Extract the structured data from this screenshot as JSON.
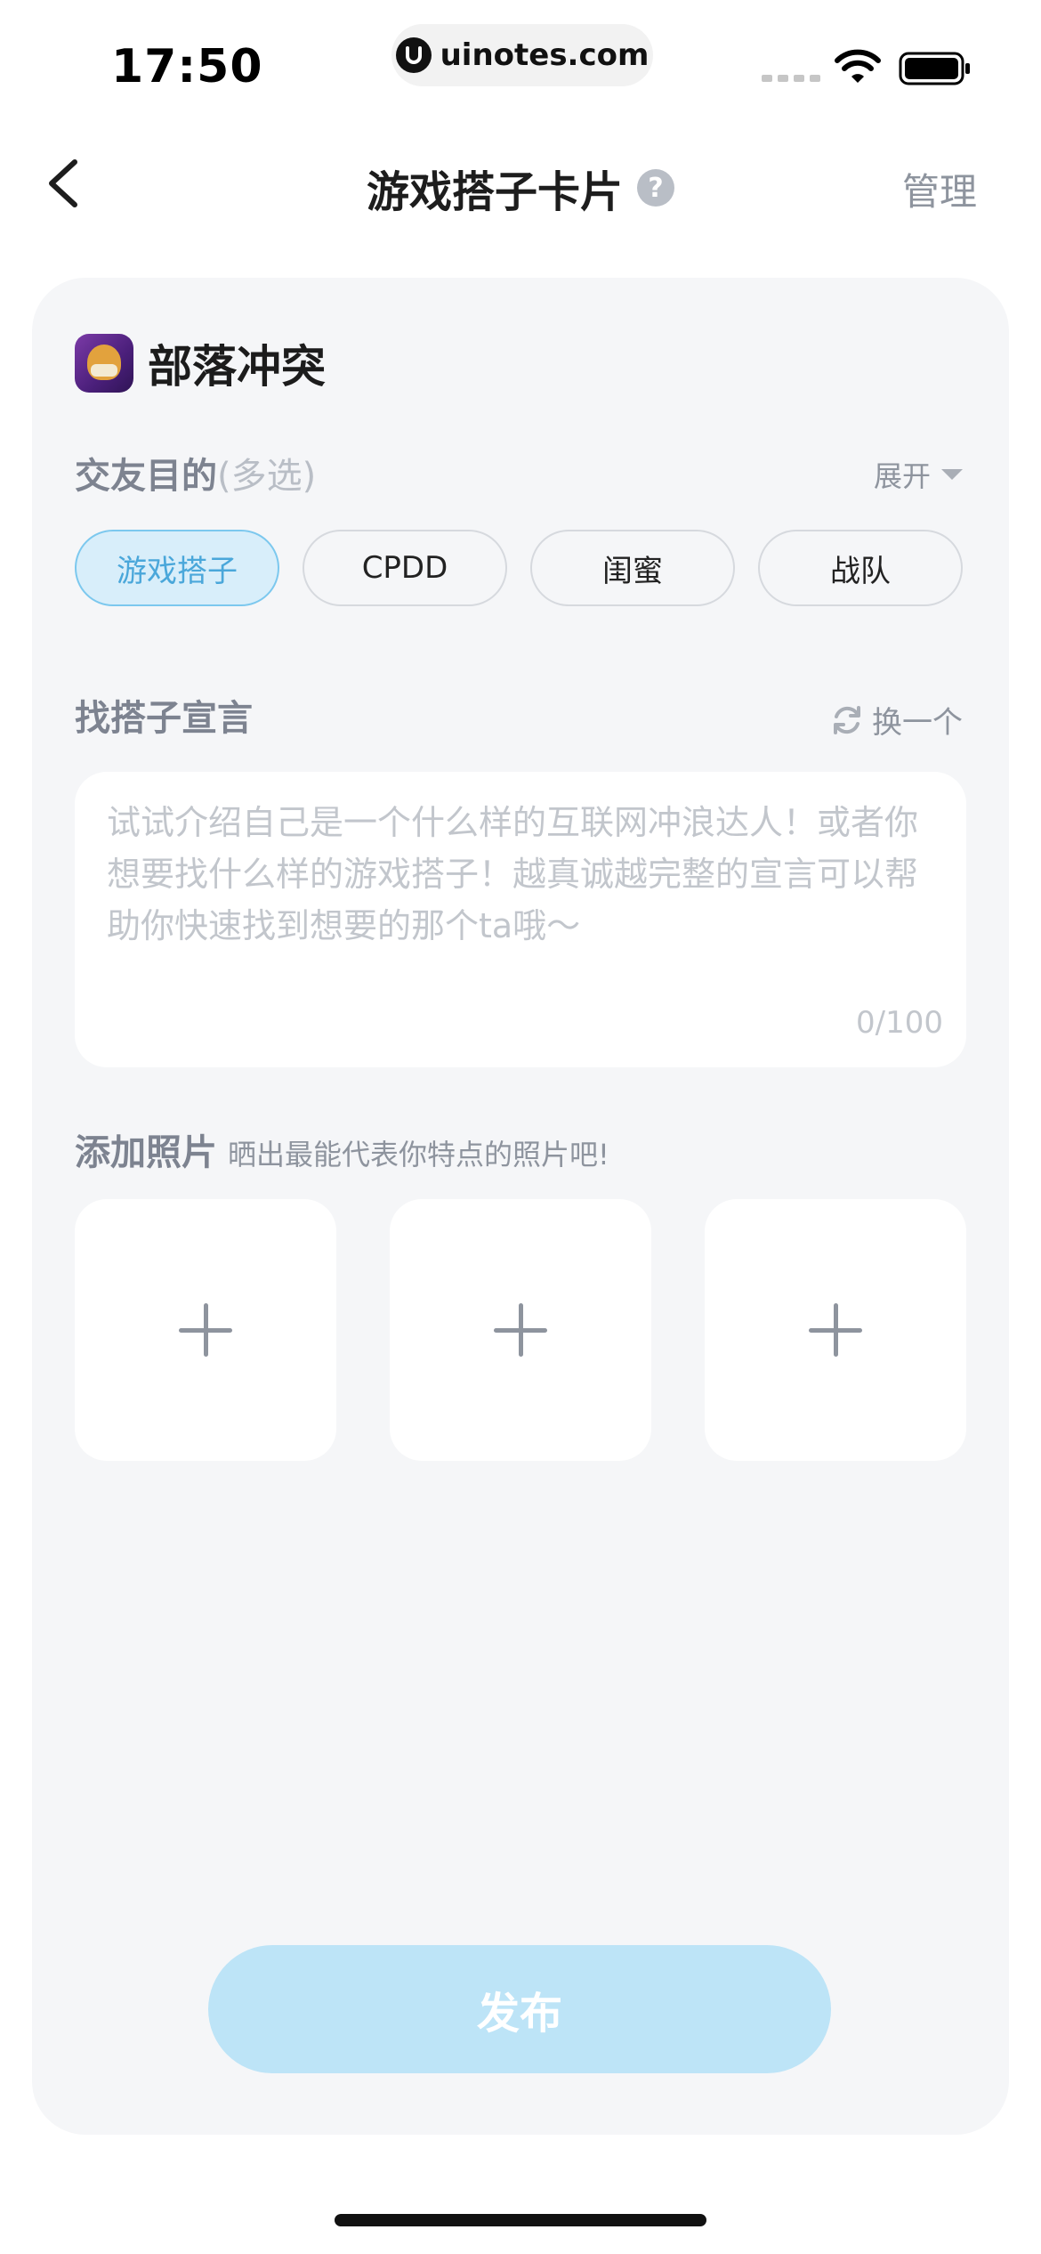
{
  "status_bar": {
    "time": "17:50",
    "url": "uinotes.com"
  },
  "nav": {
    "title": "游戏搭子卡片",
    "help_symbol": "?",
    "manage_label": "管理"
  },
  "game": {
    "name": "部落冲突",
    "icon": "clash-of-clans-app-icon"
  },
  "purpose": {
    "label": "交友目的",
    "label_suffix": "(多选)",
    "expand_label": "展开",
    "chips": [
      {
        "label": "游戏搭子",
        "selected": true
      },
      {
        "label": "CPDD",
        "selected": false
      },
      {
        "label": "闺蜜",
        "selected": false
      },
      {
        "label": "战队",
        "selected": false
      }
    ]
  },
  "declaration": {
    "label": "找搭子宣言",
    "refresh_label": "换一个",
    "placeholder": "试试介绍自己是一个什么样的互联网冲浪达人！或者你想要找什么样的游戏搭子！越真诚越完整的宣言可以帮助你快速找到想要的那个ta哦～",
    "counter": "0/100"
  },
  "photos": {
    "label": "添加照片",
    "hint": "晒出最能代表你特点的照片吧!",
    "slots": 3
  },
  "publish_label": "发布",
  "colors": {
    "accent": "#4aa7da",
    "chip_active_bg": "#d8eefa",
    "publish_bg": "#bde4f7",
    "card_bg": "#f5f6f8"
  }
}
